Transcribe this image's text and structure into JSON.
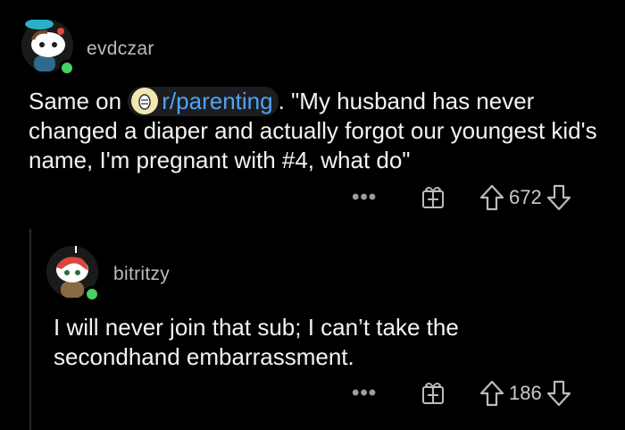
{
  "comments": [
    {
      "username": "evdczar",
      "body_prefix": "Same on ",
      "subreddit": "r/parenting",
      "body_suffix": ". \"My husband has never changed a diaper and actually forgot our youngest kid's name, I'm pregnant with #4, what do\"",
      "more_label": "•••",
      "votes": "672"
    },
    {
      "username": "bitritzy",
      "body": "I will never join that sub; I can’t take the secondhand embarrassment.",
      "more_label": "•••",
      "votes": "186"
    }
  ],
  "colors": {
    "background": "#000000",
    "link": "#4fa3f7",
    "online": "#46d160"
  }
}
